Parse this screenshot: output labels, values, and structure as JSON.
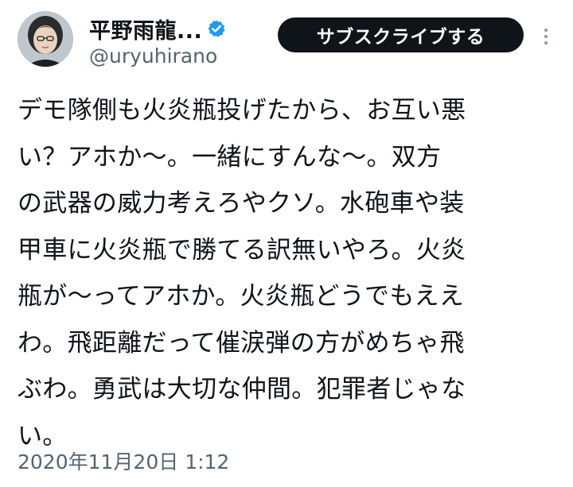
{
  "author": {
    "display_name": "平野雨龍...",
    "handle": "@uryuhirano",
    "verified": true,
    "avatar_icon": "avatar-photo"
  },
  "actions": {
    "subscribe_label": "サブスクライブする",
    "more_icon": "more-vertical-icon"
  },
  "tweet": {
    "lines": [
      "デモ隊側も火炎瓶投げたから、お互い悪",
      "い？アホか〜。一緒にすんな〜。双方",
      "の武器の威力考えろやクソ。水砲車や装",
      "甲車に火炎瓶で勝てる訳無いやろ。火炎",
      "瓶が〜ってアホか。火炎瓶どうでもええ",
      "わ。飛距離だって催涙弾の方がめちゃ飛",
      "ぶわ。勇武は大切な仲間。犯罪者じゃな",
      "い。"
    ],
    "timestamp": "2020年11月20日 1:12"
  },
  "colors": {
    "text": "#0f1419",
    "secondary_text": "#536471",
    "verified_badge": "#1d9bf0",
    "button_bg": "#0f1419",
    "button_text": "#ffffff"
  }
}
